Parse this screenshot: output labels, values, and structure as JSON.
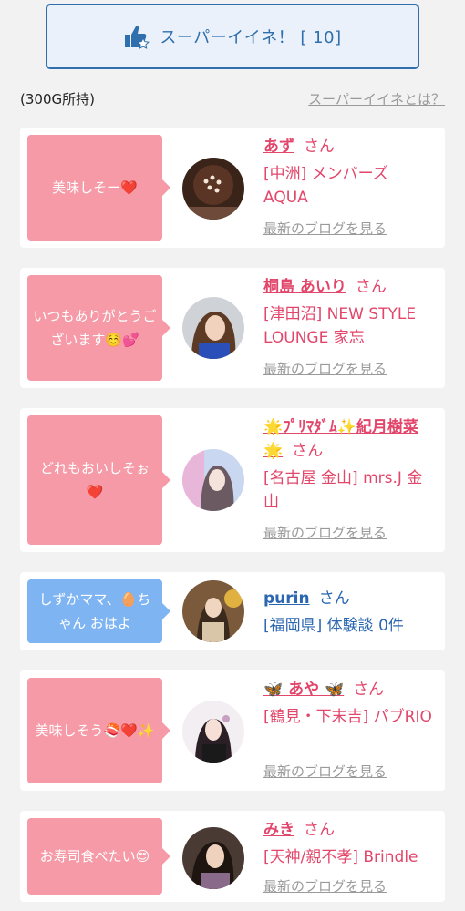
{
  "header": {
    "super_like_label": "スーパーイイネ！ [ 10]",
    "holding": "(300G所持)",
    "about_link": "スーパーイイネとは？"
  },
  "cards": [
    {
      "message": "美味しそー❤️",
      "name": "あず",
      "honorific": "さん",
      "detail": "[中洲] メンバーズAQUA",
      "blog": "最新のブログを見る"
    },
    {
      "message": "いつもありがとうございます☺️💕",
      "name": "桐島 あいり",
      "honorific": "さん",
      "detail": "[津田沼] NEW STYLE LOUNGE 家忘",
      "blog": "最新のブログを見る"
    },
    {
      "message": "どれもおいしそぉ❤️",
      "name": "🌟ﾌﾟﾘﾏﾀﾞﾑ✨紀月樹菜🌟",
      "honorific": "さん",
      "detail": "[名古屋 金山] mrs.J 金山",
      "blog": "最新のブログを見る"
    },
    {
      "message": "しずかママ、🥚ちゃん おはよ",
      "name": "purin",
      "honorific": "さん",
      "detail": "[福岡県] 体験談 0件",
      "blog": ""
    },
    {
      "message": "美味しそう🍣❤️✨",
      "name": "🦋 あや 🦋",
      "honorific": "さん",
      "detail": "[鶴見・下末吉] パブRIO",
      "blog": "最新のブログを見る"
    },
    {
      "message": "お寿司食べたい😍",
      "name": "みき",
      "honorific": "さん",
      "detail": "[天神/親不孝] Brindle",
      "blog": "最新のブログを見る"
    }
  ],
  "colors": {
    "pink_bubble": "#f59aa6",
    "blue_bubble": "#7eb4f2",
    "name_pink": "#e2466a",
    "name_blue": "#2b67b0",
    "button_border": "#2f6fad"
  }
}
